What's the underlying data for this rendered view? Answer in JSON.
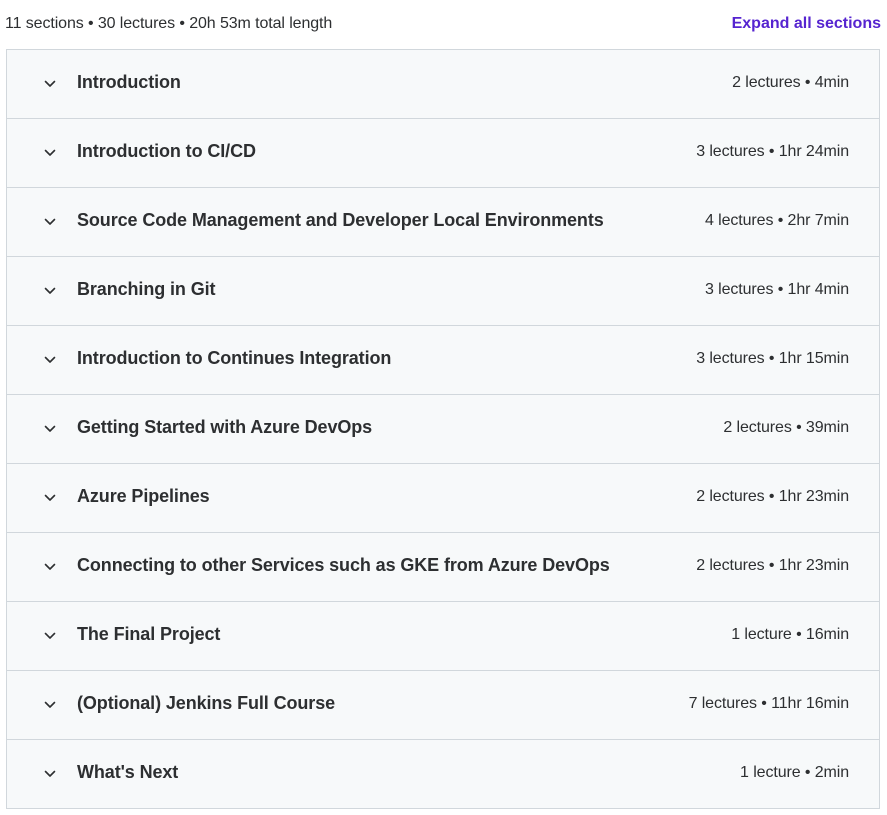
{
  "summary": {
    "text": "11 sections • 30 lectures • 20h 53m total length",
    "expand_label": "Expand all sections"
  },
  "colors": {
    "accent": "#5624d0",
    "section_bg": "#f7f9fa",
    "border": "#d1d7dc",
    "text": "#2d2f31"
  },
  "sections": [
    {
      "title": "Introduction",
      "meta": "2 lectures • 4min",
      "icon": "chevron-down-icon"
    },
    {
      "title": "Introduction to CI/CD",
      "meta": "3 lectures • 1hr 24min",
      "icon": "chevron-down-icon"
    },
    {
      "title": "Source Code Management and Developer Local Environments",
      "meta": "4 lectures • 2hr 7min",
      "icon": "chevron-down-icon"
    },
    {
      "title": "Branching in Git",
      "meta": "3 lectures • 1hr 4min",
      "icon": "chevron-down-icon"
    },
    {
      "title": "Introduction to Continues Integration",
      "meta": "3 lectures • 1hr 15min",
      "icon": "chevron-down-icon"
    },
    {
      "title": "Getting Started with Azure DevOps",
      "meta": "2 lectures • 39min",
      "icon": "chevron-down-icon"
    },
    {
      "title": "Azure Pipelines",
      "meta": "2 lectures • 1hr 23min",
      "icon": "chevron-down-icon"
    },
    {
      "title": "Connecting to other Services such as GKE from Azure DevOps",
      "meta": "2 lectures • 1hr 23min",
      "icon": "chevron-down-icon"
    },
    {
      "title": "The Final Project",
      "meta": "1 lecture • 16min",
      "icon": "chevron-down-icon"
    },
    {
      "title": "(Optional) Jenkins Full Course",
      "meta": "7 lectures • 11hr 16min",
      "icon": "chevron-down-icon"
    },
    {
      "title": "What's Next",
      "meta": "1 lecture • 2min",
      "icon": "chevron-down-icon"
    }
  ]
}
